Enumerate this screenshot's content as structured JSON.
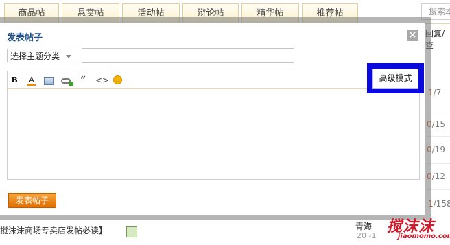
{
  "tabs": [
    {
      "label": "商品帖"
    },
    {
      "label": "悬赏帖"
    },
    {
      "label": "活动帖"
    },
    {
      "label": "辩论帖"
    },
    {
      "label": "精华帖"
    },
    {
      "label": "推荐帖"
    }
  ],
  "search": {
    "placeholder": "搜索本"
  },
  "background_list": {
    "header": "回复/查",
    "stats": [
      {
        "reply": "1",
        "views": "/7"
      },
      {
        "reply": "0",
        "views": "/15"
      },
      {
        "reply": "0",
        "views": "/19"
      },
      {
        "reply": "0",
        "views": "/12"
      },
      {
        "reply": "1",
        "views": "/158"
      }
    ],
    "footer_title": "搅沫沫商场专卖店发帖必读】",
    "footer_author": "青海",
    "footer_date": "20 -1"
  },
  "dialog": {
    "title": "发表帖子",
    "close_label": "×",
    "category_select": "选择主题分类",
    "title_input_value": "",
    "advanced_mode": "高级模式",
    "submit": "发表帖子"
  },
  "toolbar": {
    "bold": "B",
    "font_color": "A",
    "quote": "“",
    "code": "<>"
  },
  "logo": {
    "word": "搅沫沫",
    "sub": "jiaomomo.com"
  },
  "colors": {
    "accent": "#1d4f8c",
    "highlight": "#0a0adc",
    "submit": "#e06e00",
    "stat_red": "#c0562d"
  }
}
